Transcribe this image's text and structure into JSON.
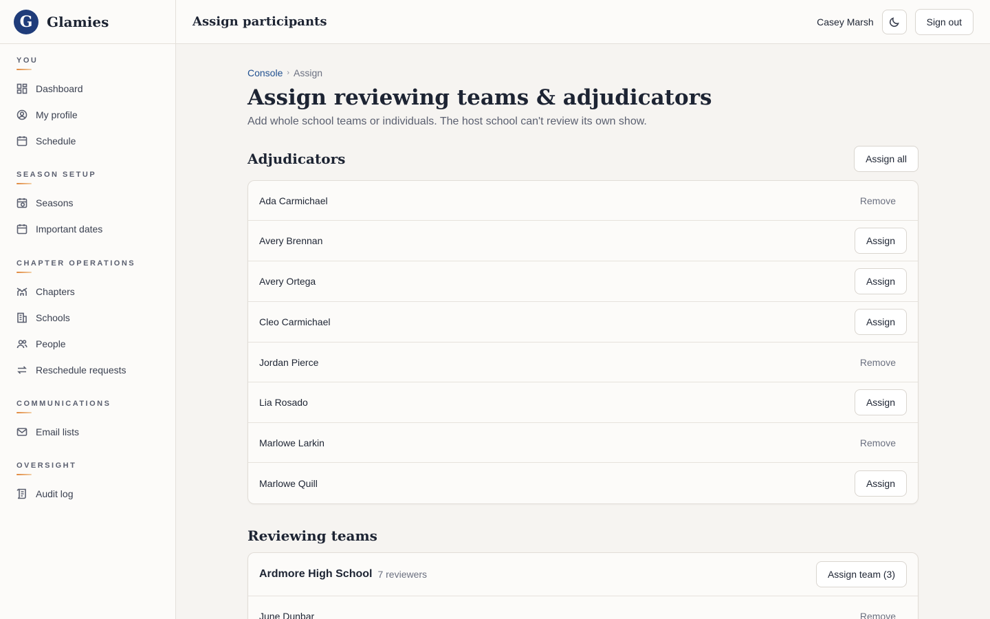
{
  "brand": {
    "name": "Glamies",
    "logo_letter": "G"
  },
  "sidebar": {
    "sections": [
      {
        "heading": "YOU",
        "items": [
          {
            "label": "Dashboard",
            "icon": "dashboard-icon"
          },
          {
            "label": "My profile",
            "icon": "user-circle-icon"
          },
          {
            "label": "Schedule",
            "icon": "calendar-icon"
          }
        ]
      },
      {
        "heading": "SEASON SETUP",
        "items": [
          {
            "label": "Seasons",
            "icon": "calendar-clock-icon"
          },
          {
            "label": "Important dates",
            "icon": "calendar-icon"
          }
        ]
      },
      {
        "heading": "CHAPTER OPERATIONS",
        "items": [
          {
            "label": "Chapters",
            "icon": "chapters-icon"
          },
          {
            "label": "Schools",
            "icon": "building-icon"
          },
          {
            "label": "People",
            "icon": "people-icon"
          },
          {
            "label": "Reschedule requests",
            "icon": "swap-icon"
          }
        ]
      },
      {
        "heading": "COMMUNICATIONS",
        "items": [
          {
            "label": "Email lists",
            "icon": "mail-icon"
          }
        ]
      },
      {
        "heading": "OVERSIGHT",
        "items": [
          {
            "label": "Audit log",
            "icon": "audit-log-icon"
          }
        ]
      }
    ]
  },
  "topbar": {
    "title": "Assign participants",
    "user_name": "Casey Marsh",
    "theme_icon": "moon-icon",
    "sign_out": "Sign out"
  },
  "breadcrumb": {
    "root": "Console",
    "current": "Assign"
  },
  "page": {
    "title": "Assign reviewing teams & adjudicators",
    "subtitle": "Add whole school teams or individuals. The host school can't review its own show."
  },
  "adjudicators": {
    "heading": "Adjudicators",
    "assign_all": "Assign all",
    "rows": [
      {
        "name": "Ada Carmichael",
        "action": "Remove"
      },
      {
        "name": "Avery Brennan",
        "action": "Assign"
      },
      {
        "name": "Avery Ortega",
        "action": "Assign"
      },
      {
        "name": "Cleo Carmichael",
        "action": "Assign"
      },
      {
        "name": "Jordan Pierce",
        "action": "Remove"
      },
      {
        "name": "Lia Rosado",
        "action": "Assign"
      },
      {
        "name": "Marlowe Larkin",
        "action": "Remove"
      },
      {
        "name": "Marlowe Quill",
        "action": "Assign"
      }
    ]
  },
  "teams": {
    "heading": "Reviewing teams",
    "items": [
      {
        "school": "Ardmore High School",
        "count": "7 reviewers",
        "assign_label": "Assign team (3)",
        "members": [
          {
            "name": "June Dunbar",
            "action": "Remove"
          }
        ]
      }
    ]
  },
  "colors": {
    "accent": "#1f3c7a",
    "link": "#1f4f8f",
    "underline": "#e0863a"
  }
}
